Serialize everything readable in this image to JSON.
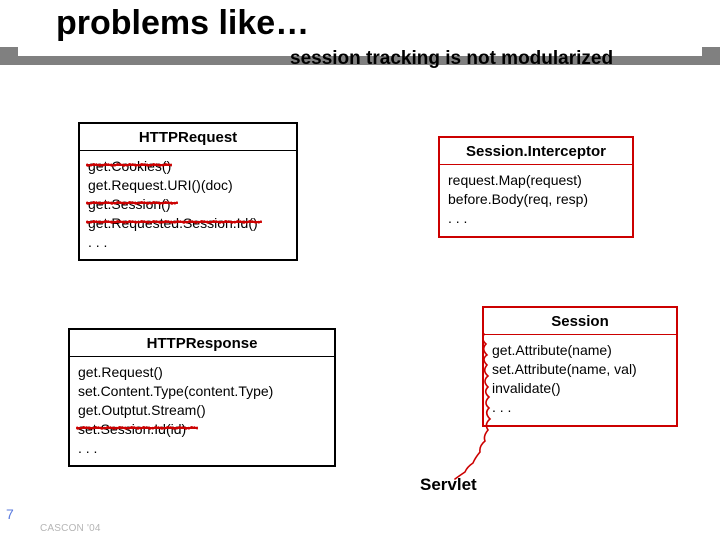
{
  "title": "problems like…",
  "subtitle": "session tracking is not modularized",
  "boxes": {
    "http_request": {
      "title": "HTTPRequest",
      "m0": "get.Cookies()",
      "m1": "get.Request.URI()(doc)",
      "m2": "get.Session()",
      "m3": "get.Requested.Session.Id()",
      "m4": ". . ."
    },
    "session_interceptor": {
      "title": "Session.Interceptor",
      "m0": "request.Map(request)",
      "m1": "before.Body(req, resp)",
      "m2": ". . ."
    },
    "http_response": {
      "title": "HTTPResponse",
      "m0": "get.Request()",
      "m1": "set.Content.Type(content.Type)",
      "m2": "get.Outptut.Stream()",
      "m3": "set.Session.Id(id)",
      "m4": ". . ."
    },
    "session": {
      "title": "Session",
      "m0": "get.Attribute(name)",
      "m1": "set.Attribute(name, val)",
      "m2": "invalidate()",
      "m3": ". . ."
    }
  },
  "servlet_label": "Servlet",
  "slide_number": "7",
  "footer": "CASCON '04",
  "colors": {
    "highlight": "#cc0000",
    "gray_strip": "#808080",
    "slide_num": "#5b7bde"
  }
}
